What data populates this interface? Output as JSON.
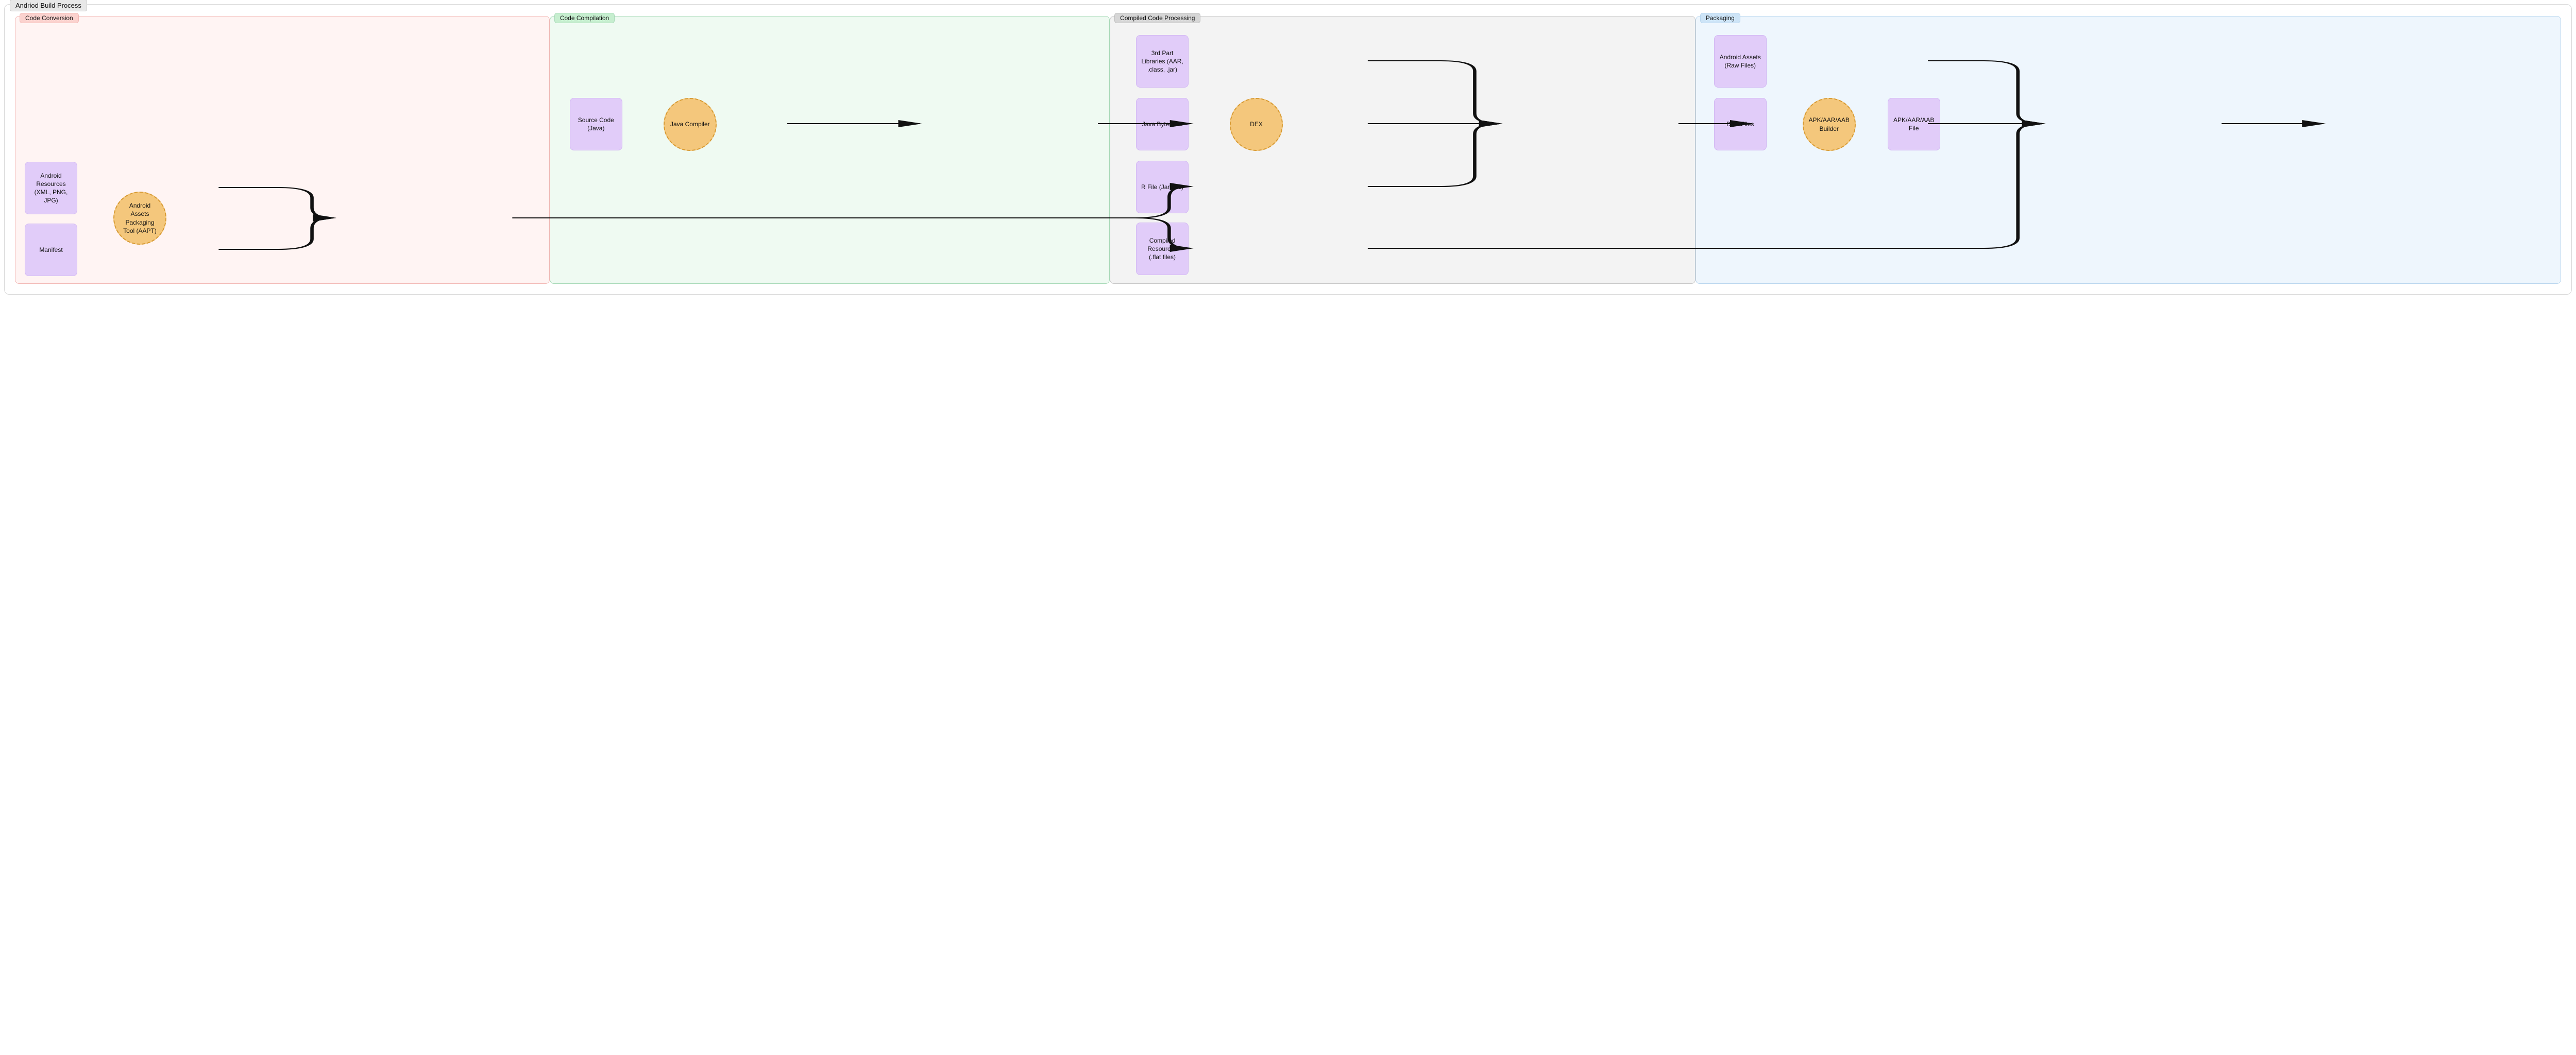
{
  "diagram": {
    "title": "Andriod Build Process",
    "lanes": {
      "conversion": {
        "label": "Code Conversion"
      },
      "compilation": {
        "label": "Code Compilation"
      },
      "compiled": {
        "label": "Compiled Code Processing"
      },
      "packaging": {
        "label": "Packaging"
      }
    },
    "nodes": {
      "resources": "Android Resources\n(XML, PNG, JPG)",
      "manifest": "Manifest",
      "aapt": "Android Assets Packaging Tool (AAPT)",
      "source": "Source Code\n(Java)",
      "javac": "Java Compiler",
      "libs": "3rd Part Libraries (AAR, .class, .jar)",
      "bytecode": "Java Bytecode",
      "rfile": "R File\n(Jar File)",
      "flat": "Compiled Resources\n(.flat files)",
      "dex": "DEX",
      "assets": "Android Assets\n(Raw Files)",
      "dexfiles": "DEX Files",
      "builder": "APK/AAR/AAB Builder",
      "output": "APK/AAR/AAB File"
    }
  }
}
